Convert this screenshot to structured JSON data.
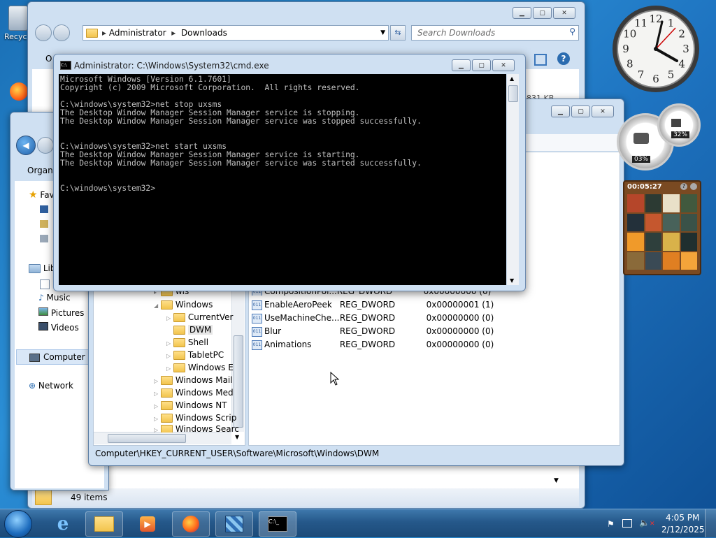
{
  "desktop": {
    "recycle_bin_label": "Recyc"
  },
  "explorer_back": {
    "breadcrumb": [
      "Administrator",
      "Downloads"
    ],
    "search_placeholder": "Search Downloads",
    "organize_fragment": "O",
    "size_fragment": "831 KB",
    "status": "49 items"
  },
  "explorer_front": {
    "organize_label": "Organiz",
    "nav": [
      {
        "label": "Fav",
        "icon": "star-icon"
      },
      {
        "label": "Lib",
        "icon": "library-icon"
      },
      {
        "label": "Music",
        "icon": "music-icon"
      },
      {
        "label": "Pictures",
        "icon": "pictures-icon"
      },
      {
        "label": "Videos",
        "icon": "videos-icon"
      },
      {
        "label": "Computer",
        "icon": "computer-icon"
      },
      {
        "label": "Network",
        "icon": "network-icon"
      }
    ]
  },
  "regedit": {
    "tree": [
      {
        "label": "Windows",
        "expander": "expanded"
      },
      {
        "label": "CurrentVer",
        "expander": "collapsed"
      },
      {
        "label": "DWM",
        "expander": "none"
      },
      {
        "label": "Shell",
        "expander": "collapsed"
      },
      {
        "label": "TabletPC",
        "expander": "collapsed"
      },
      {
        "label": "Windows E",
        "expander": "collapsed"
      },
      {
        "label": "Windows Mail",
        "expander": "collapsed"
      },
      {
        "label": "Windows Med",
        "expander": "collapsed"
      },
      {
        "label": "Windows NT",
        "expander": "collapsed"
      },
      {
        "label": "Windows Scrip",
        "expander": "collapsed"
      },
      {
        "label": "Windows Searc",
        "expander": "collapsed"
      }
    ],
    "tree_partial_top": "wis",
    "values": [
      {
        "name": "CompositionPol...",
        "type": "REG_DWORD",
        "data": "0x00000000 (0)"
      },
      {
        "name": "EnableAeroPeek",
        "type": "REG_DWORD",
        "data": "0x00000001 (1)"
      },
      {
        "name": "UseMachineChe...",
        "type": "REG_DWORD",
        "data": "0x00000000 (0)"
      },
      {
        "name": "Blur",
        "type": "REG_DWORD",
        "data": "0x00000000 (0)"
      },
      {
        "name": "Animations",
        "type": "REG_DWORD",
        "data": "0x00000000 (0)"
      }
    ],
    "status_path": "Computer\\HKEY_CURRENT_USER\\Software\\Microsoft\\Windows\\DWM"
  },
  "cmd": {
    "title": "Administrator: C:\\Windows\\System32\\cmd.exe",
    "lines": [
      "Microsoft Windows [Version 6.1.7601]",
      "Copyright (c) 2009 Microsoft Corporation.  All rights reserved.",
      "",
      "C:\\windows\\system32>net stop uxsms",
      "The Desktop Window Manager Session Manager service is stopping.",
      "The Desktop Window Manager Session Manager service was stopped successfully.",
      "",
      "",
      "C:\\windows\\system32>net start uxsms",
      "The Desktop Window Manager Session Manager service is starting.",
      "The Desktop Window Manager Session Manager service was started successfully.",
      "",
      "",
      "C:\\windows\\system32>"
    ]
  },
  "gadgets": {
    "clock_numerals": [
      "12",
      "1",
      "2",
      "3",
      "4",
      "5",
      "6",
      "7",
      "8",
      "9",
      "10",
      "11"
    ],
    "cpu_percent": "03%",
    "mem_percent": "32%",
    "puzzle_timer": "00:05:27"
  },
  "taskbar": {
    "time": "4:05 PM",
    "date": "2/12/2025"
  },
  "colors": {
    "accent": "#2b6cb0",
    "taskbar": "#25588a"
  }
}
